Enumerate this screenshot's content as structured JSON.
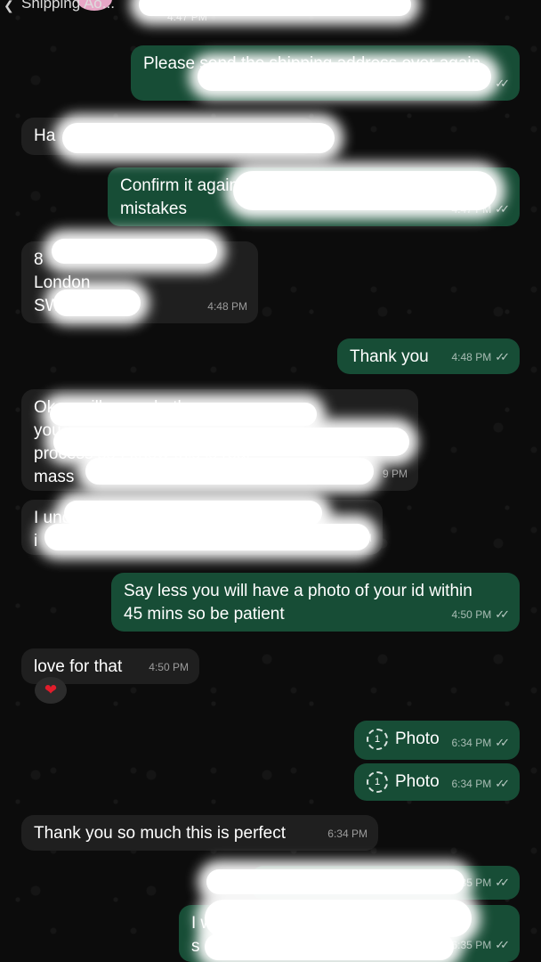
{
  "header": {
    "partial_preview": "Shipping Ao...",
    "partial_time": "4:47 PM"
  },
  "messages": {
    "m1": {
      "text": "Please send the shipping address over again",
      "time": "",
      "ticks": "✓✓"
    },
    "m2": {
      "text": "Ha",
      "time": ""
    },
    "m3": {
      "text": "Confirm it again\nmistakes",
      "time": "4:47 PM",
      "ticks": "✓✓"
    },
    "m4": {
      "text": "8\nLondon\nSW",
      "time": "4:48 PM"
    },
    "m5": {
      "text": "Thank you",
      "time": "4:48 PM",
      "ticks": "✓✓"
    },
    "m6": {
      "text": "Ok ... will never bother\nyou\nprocess so I know this is real\nmass",
      "time": "9 PM"
    },
    "m7": {
      "text": "I und ... and\ni",
      "time": "PM"
    },
    "m8": {
      "text": "Say less you will have a photo of your id within\n45 mins so be patient",
      "time": "4:50 PM",
      "ticks": "✓✓"
    },
    "m9": {
      "text": "love for that",
      "time": "4:50 PM",
      "reaction": "❤"
    },
    "m10": {
      "icon": "1",
      "text": "Photo",
      "time": "6:34 PM",
      "ticks": "✓✓"
    },
    "m11": {
      "icon": "1",
      "text": "Photo",
      "time": "6:34 PM",
      "ticks": "✓✓"
    },
    "m12": {
      "text": "Thank you so much this is perfect",
      "time": "6:34 PM"
    },
    "m13": {
      "text": "I told you don't p",
      "time": "35 PM",
      "ticks": "✓✓"
    },
    "m14": {
      "text": "I w ... nge\ns",
      "time": "6:35 PM",
      "ticks": "✓✓"
    }
  },
  "colors": {
    "incoming": "#1f1f1f",
    "outgoing": "#174d36",
    "background": "#0b0b0b"
  }
}
